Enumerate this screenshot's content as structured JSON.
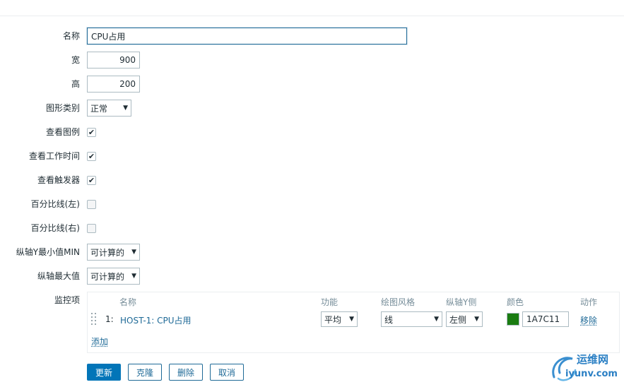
{
  "form": {
    "name_label": "名称",
    "name_value": "CPU占用",
    "width_label": "宽",
    "width_value": "900",
    "height_label": "高",
    "height_value": "200",
    "graph_type_label": "图形类别",
    "graph_type_value": "正常",
    "show_legend_label": "查看图例",
    "show_legend_checked": true,
    "show_working_time_label": "查看工作时间",
    "show_working_time_checked": true,
    "show_triggers_label": "查看触发器",
    "show_triggers_checked": true,
    "percentile_left_label": "百分比线(左)",
    "percentile_left_checked": false,
    "percentile_right_label": "百分比线(右)",
    "percentile_right_checked": false,
    "ymin_label": "纵轴Y最小值MIN",
    "ymin_value": "可计算的",
    "ymax_label": "纵轴最大值",
    "ymax_value": "可计算的",
    "items_label": "监控项"
  },
  "items_table": {
    "headers": {
      "name": "名称",
      "function": "功能",
      "draw_style": "绘图风格",
      "y_axis_side": "纵轴Y侧",
      "color": "颜色",
      "action": "动作"
    },
    "rows": [
      {
        "num": "1:",
        "name": "HOST-1: CPU占用",
        "function": "平均",
        "draw_style": "线",
        "y_axis_side": "左侧",
        "color_hex": "#1A7C11",
        "color_value": "1A7C11",
        "action": "移除"
      }
    ],
    "add_label": "添加"
  },
  "buttons": {
    "update": "更新",
    "clone": "克隆",
    "delete": "删除",
    "cancel": "取消"
  },
  "icons": {
    "checked": "check-icon",
    "dropdown": "chevron-down-icon",
    "drag": "drag-handle-icon"
  },
  "colors": {
    "primary": "#0275b8",
    "link": "#1f6a97",
    "item_color": "#1A7C11"
  },
  "watermark": {
    "title": "运维网",
    "site": "iyunv.com"
  }
}
